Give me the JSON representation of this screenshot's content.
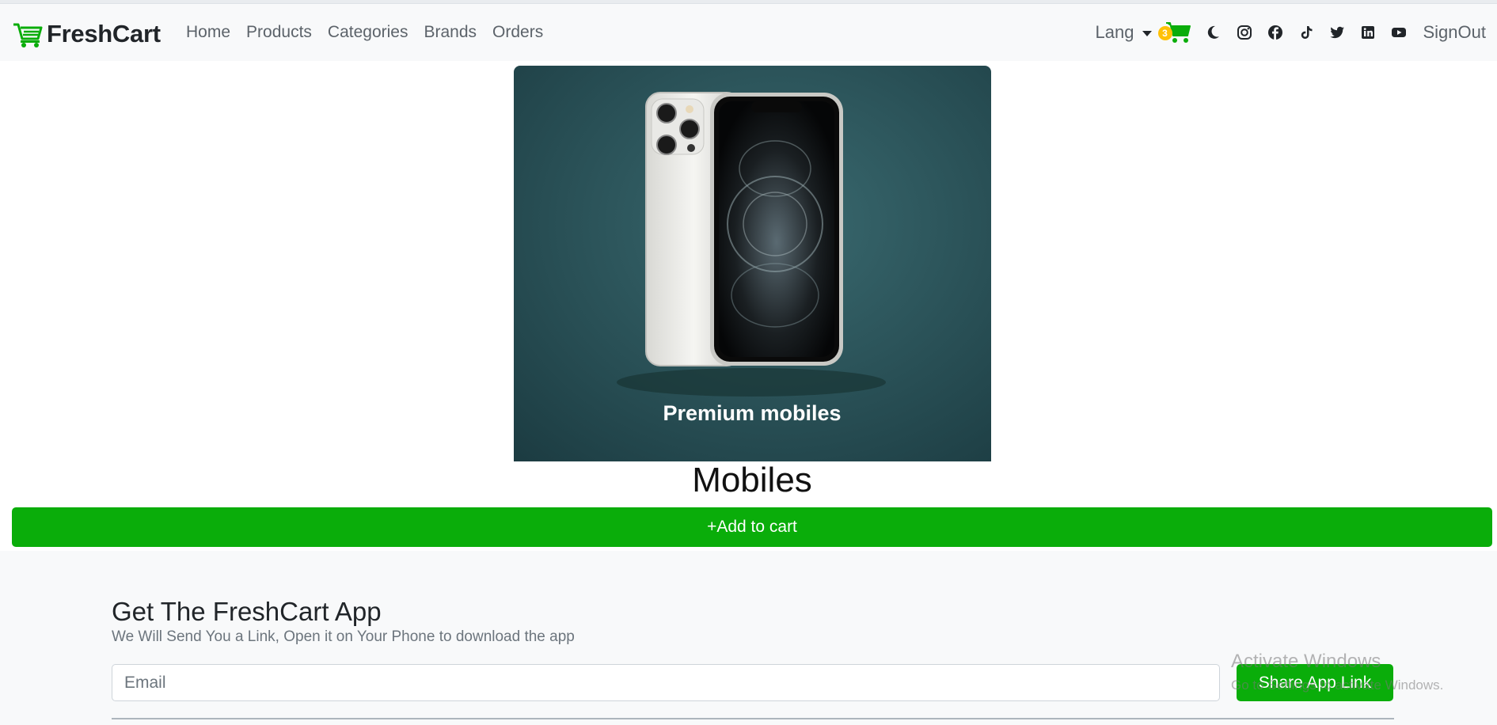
{
  "brand": {
    "name": "FreshCart"
  },
  "nav": {
    "links": [
      "Home",
      "Products",
      "Categories",
      "Brands",
      "Orders"
    ],
    "lang_label": "Lang",
    "cart_count": "3",
    "social_icons": [
      "moon-icon",
      "instagram-icon",
      "facebook-icon",
      "tiktok-icon",
      "twitter-icon",
      "linkedin-icon",
      "youtube-icon"
    ],
    "signout_label": "SignOut"
  },
  "product": {
    "image_caption": "Premium mobiles",
    "title": "Mobiles",
    "add_to_cart_label": "+Add to cart"
  },
  "footer": {
    "title": "Get The FreshCart App",
    "subtitle": "We Will Send You a Link, Open it on Your Phone to download the app",
    "email_placeholder": "Email",
    "share_label": "Share App Link"
  },
  "watermark": {
    "title": "Activate Windows",
    "subtitle": "Go to Settings to activate Windows."
  },
  "colors": {
    "accent": "#0aad0a",
    "navbar_bg": "#f8f9fa",
    "badge": "#ffc107",
    "hero_bg": "#2a4f55"
  }
}
